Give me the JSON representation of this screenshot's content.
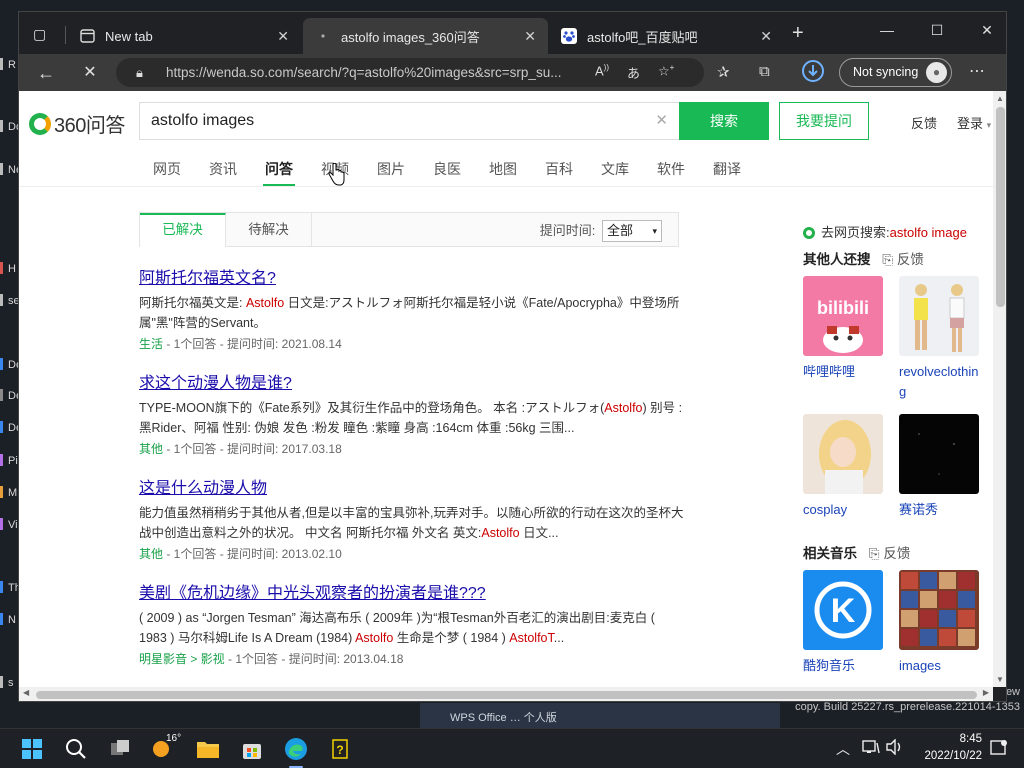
{
  "desktop": {
    "items": [
      {
        "label": "R",
        "color": "#bbbbbb"
      },
      {
        "label": "Dow",
        "color": "#bbbbbb"
      },
      {
        "label": "New",
        "color": "#bbbbbb"
      },
      {
        "label": "H",
        "color": "#d9534f"
      },
      {
        "label": "se",
        "color": "#bbbbbb"
      },
      {
        "label": "De",
        "color": "#3a87f0"
      },
      {
        "label": "De",
        "color": "#8a8a8a"
      },
      {
        "label": "De",
        "color": "#3a87f0"
      },
      {
        "label": "Pi",
        "color": "#b470e8"
      },
      {
        "label": "M",
        "color": "#e8a13a"
      },
      {
        "label": "Vi",
        "color": "#b470e8"
      },
      {
        "label": "Th",
        "color": "#3a87f0"
      },
      {
        "label": "N",
        "color": "#3a87f0"
      },
      {
        "label": "s",
        "color": "#bbbbbb"
      }
    ],
    "bottom_text": "WPS Office … 个人版",
    "ew_text": "ew",
    "build_text": "copy. Build 25227.rs_prerelease.221014-1353"
  },
  "tabs": [
    {
      "label": "New tab",
      "icon": "new-tab-icon"
    },
    {
      "label": "astolfo images_360问答",
      "icon": "loading-icon"
    },
    {
      "label": "astolfo吧_百度贴吧",
      "icon": "baidu-paw-icon"
    }
  ],
  "address": {
    "url": "https://wenda.so.com/search/?q=astolfo%20images&src=srp_su...",
    "sync_label": "Not syncing"
  },
  "site": {
    "logo_text": "360问答",
    "search_value": "astolfo images",
    "search_button": "搜索",
    "ask_button": "我要提问",
    "feedback": "反馈",
    "login": "登录"
  },
  "nav_tabs": [
    "网页",
    "资讯",
    "问答",
    "视频",
    "图片",
    "良医",
    "地图",
    "百科",
    "文库",
    "软件",
    "翻译"
  ],
  "sub_tabs": {
    "solved": "已解决",
    "pending": "待解决",
    "time_label": "提问时间:",
    "time_value": "全部"
  },
  "results": [
    {
      "title": "阿斯托尔福英文名?",
      "desc_pre": "阿斯托尔福英文是: ",
      "desc_em": "Astolfo",
      "desc_post": " 日文是:アストルフォ阿斯托尔福是轻小说《Fate/Apocrypha》中登场所属\"黑\"阵营的Servant。",
      "desc_em2": "",
      "desc_tail": "",
      "cat": "生活",
      "meta": " - 1个回答 - 提问时间: 2021.08.14"
    },
    {
      "title": "求这个动漫人物是谁?",
      "desc_pre": "TYPE-MOON旗下的《Fate系列》及其衍生作品中的登场角色。 本名 :アストルフォ(",
      "desc_em": "Astolfo",
      "desc_post": ") 别号 :黑Rider、阿福 性别: 伪娘 发色 :粉发 瞳色 :紫瞳 身高 :164cm 体重 :56kg 三围...",
      "desc_em2": "",
      "desc_tail": "",
      "cat": "其他",
      "meta": " - 1个回答 - 提问时间: 2017.03.18"
    },
    {
      "title": "这是什么动漫人物",
      "desc_pre": "能力值虽然稍稍劣于其他从者,但是以丰富的宝具弥补,玩弄对手。以随心所欲的行动在这次的圣杯大战中创造出意料之外的状况。 中文名 阿斯托尔福 外文名 英文:",
      "desc_em": "Astolfo",
      "desc_post": " 日文...",
      "desc_em2": "",
      "desc_tail": "",
      "cat": "其他",
      "meta": " - 1个回答 - 提问时间: 2013.02.10"
    },
    {
      "title": "美剧《危机边缘》中光头观察者的扮演者是谁???",
      "desc_pre": "( 2009 ) as “Jorgen Tesman” 海达高布乐 ( 2009年 )为“根Tesman外百老汇的演出剧目:麦克白 ( 1983 ) 马尔科姆Life Is A Dream (1984) ",
      "desc_em": "Astolfo",
      "desc_post": " 生命是个梦 ( 1984 ) ",
      "desc_em2": "AstolfoT",
      "desc_tail": "...",
      "cat": "明星影音 > 影视",
      "meta": " - 1个回答 - 提问时间: 2013.04.18"
    }
  ],
  "sidebar": {
    "web_search_prefix": "去网页搜索:",
    "web_search_query": "astolfo image",
    "others_title": "其他人还搜",
    "feedback": "反馈",
    "others": [
      {
        "label": "哔哩哔哩",
        "thumb": "bilibili-logo"
      },
      {
        "label": "revolveclothing",
        "thumb": "fashion-photo"
      },
      {
        "label": "cosplay",
        "thumb": "cosplay-photo"
      },
      {
        "label": "赛诺秀",
        "thumb": "dark-photo"
      }
    ],
    "music_title": "相关音乐",
    "music": [
      {
        "label": "酷狗音乐",
        "thumb": "kugou-logo"
      },
      {
        "label": "images",
        "thumb": "album-grid"
      }
    ]
  },
  "taskbar": {
    "weather": "16°",
    "time": "8:45",
    "date": "2022/10/22"
  }
}
